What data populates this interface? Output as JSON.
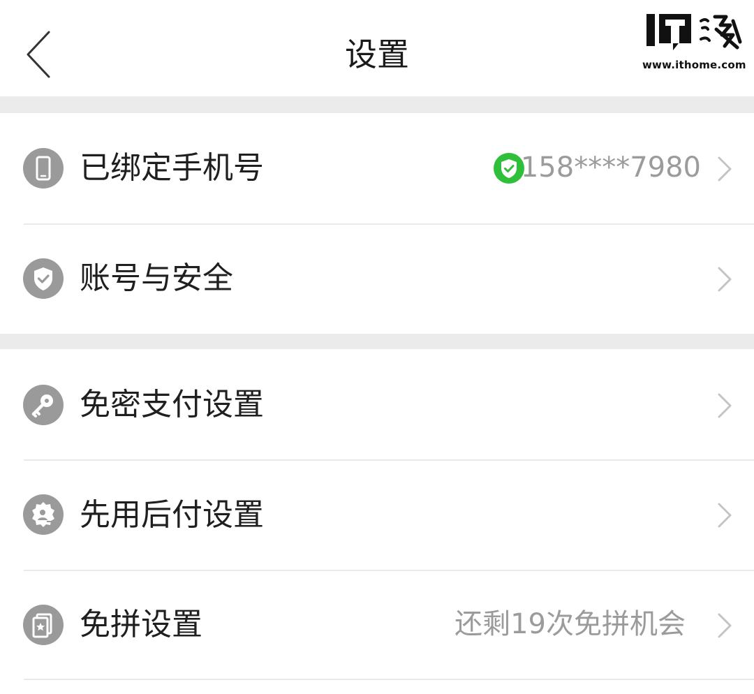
{
  "header": {
    "title": "设置",
    "back_icon": "chevron-left-icon"
  },
  "watermark": {
    "url": "www.ithome.com"
  },
  "settings": [
    {
      "label": "已绑定手机号",
      "icon": "phone-icon",
      "value": "158****7980",
      "value_icon": "verified-shield-icon",
      "value_icon_color": "#2fbf3a"
    },
    {
      "label": "账号与安全",
      "icon": "shield-check-icon",
      "value": ""
    },
    {
      "label": "免密支付设置",
      "icon": "key-icon",
      "value": ""
    },
    {
      "label": "先用后付设置",
      "icon": "badge-user-icon",
      "value": ""
    },
    {
      "label": "免拼设置",
      "icon": "card-star-icon",
      "value": "还剩19次免拼机会"
    }
  ],
  "colors": {
    "icon_bg": "#9a9a9a",
    "separator": "#ebebeb",
    "verified": "#2fbf3a",
    "value_text": "#9b9b9b"
  }
}
